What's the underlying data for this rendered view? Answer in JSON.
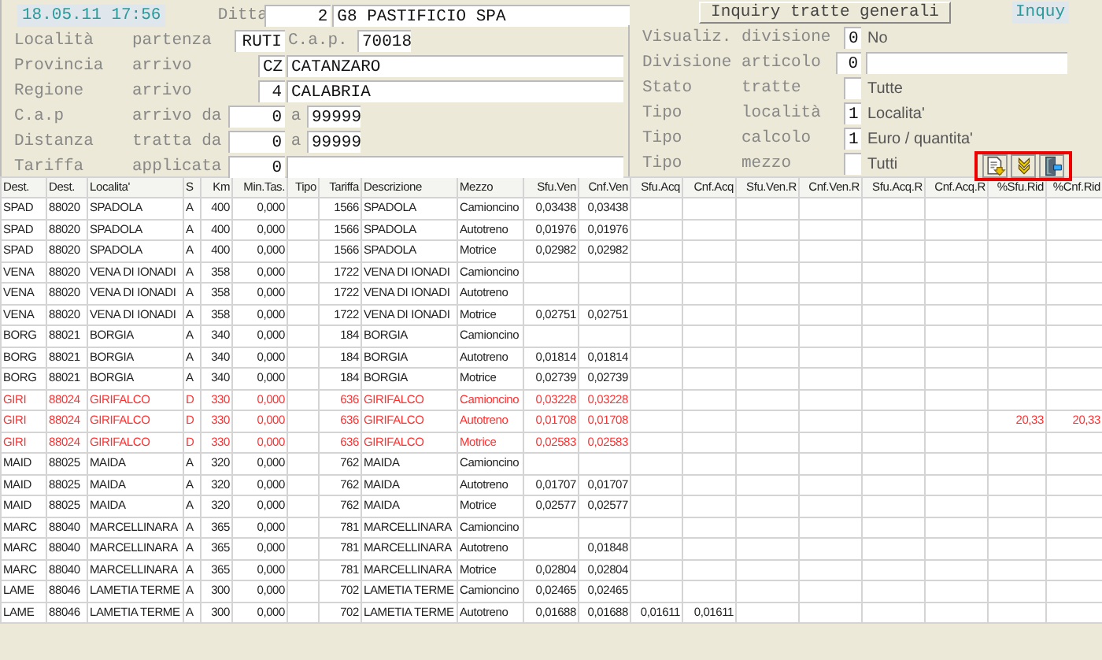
{
  "date_time": "18.05.11 17:56",
  "company": {
    "label": "Ditta",
    "code": "2",
    "name": "G8 PASTIFICIO SPA"
  },
  "left_form": {
    "rows": [
      {
        "label": "Località",
        "label_2": "partenza",
        "items": [
          {
            "kind": "field",
            "value": "RUTI"
          },
          {
            "kind": "label",
            "text": "C.a.p."
          },
          {
            "kind": "field",
            "value": "70018"
          }
        ]
      },
      {
        "label": "Provincia",
        "label_2": "arrivo",
        "items": [
          {
            "kind": "field",
            "value": "CZ"
          },
          {
            "kind": "field",
            "value": "CATANZARO"
          }
        ]
      },
      {
        "label": "Regione",
        "label_2": "arrivo",
        "items": [
          {
            "kind": "field",
            "value": "4"
          },
          {
            "kind": "field",
            "value": "CALABRIA"
          }
        ]
      },
      {
        "label": "C.a.p",
        "label_2": "arrivo da",
        "items": [
          {
            "kind": "field",
            "value": "0"
          },
          {
            "kind": "label",
            "text": "a"
          },
          {
            "kind": "field",
            "value": "99999"
          }
        ]
      },
      {
        "label": "Distanza",
        "label_2": "tratta da",
        "items": [
          {
            "kind": "field",
            "value": "0"
          },
          {
            "kind": "label",
            "text": "a"
          },
          {
            "kind": "field",
            "value": "99999"
          }
        ]
      },
      {
        "label": "Tariffa",
        "label_2": "applicata",
        "items": [
          {
            "kind": "field",
            "value": "0"
          },
          {
            "kind": "field"
          }
        ]
      }
    ]
  },
  "title_button": "Inquiry tratte generali",
  "mode_label": "Inquy",
  "right_form": {
    "rows": [
      {
        "label": "Visualiz.",
        "label_2": "divisione",
        "items": [
          {
            "kind": "field",
            "value": "0"
          },
          {
            "kind": "text",
            "text": "No"
          }
        ]
      },
      {
        "label": "Divisione",
        "label_2": "articolo",
        "items": [
          {
            "kind": "field",
            "value": "0"
          },
          {
            "kind": "field"
          }
        ]
      },
      {
        "label": "Stato",
        "label_2": "tratte",
        "items": [
          {
            "kind": "field"
          },
          {
            "kind": "text",
            "text": "Tutte"
          }
        ]
      },
      {
        "label": "Tipo",
        "label_2": "località",
        "items": [
          {
            "kind": "field",
            "value": "1"
          },
          {
            "kind": "text",
            "text": "Localita'"
          }
        ]
      },
      {
        "label": "Tipo",
        "label_2": "calcolo",
        "items": [
          {
            "kind": "field",
            "value": "1"
          },
          {
            "kind": "text",
            "text": "Euro / quantita'"
          }
        ]
      },
      {
        "label": "Tipo",
        "label_2": "mezzo",
        "items": [
          {
            "kind": "field"
          },
          {
            "kind": "text",
            "text": "Tutti"
          }
        ]
      }
    ]
  },
  "toolbar": [
    {
      "kind": "export"
    },
    {
      "kind": "expand"
    },
    {
      "kind": "exit"
    }
  ],
  "table": {
    "columns": [
      "Dest.",
      "Dest.",
      "Localita'",
      "S",
      "Km",
      "Min.Tas.",
      "Tipo",
      "Tariffa",
      "Descrizione",
      "Mezzo",
      "Sfu.Ven",
      "Cnf.Ven",
      "Sfu.Acq",
      "Cnf.Acq",
      "Sfu.Ven.R",
      "Cnf.Ven.R",
      "Sfu.Acq.R",
      "Cnf.Acq.R",
      "%Sfu.Rid",
      "%Cnf.Rid"
    ],
    "rows": [
      {
        "highlighted": false,
        "cells": [
          "SPAD",
          "88020",
          "SPADOLA",
          "A",
          "400",
          "0,000",
          null,
          "1566",
          "SPADOLA",
          "Camioncino",
          "0,03438",
          "0,03438",
          null,
          null,
          null,
          null,
          null,
          null,
          null,
          null
        ]
      },
      {
        "highlighted": false,
        "cells": [
          "SPAD",
          "88020",
          "SPADOLA",
          "A",
          "400",
          "0,000",
          null,
          "1566",
          "SPADOLA",
          "Autotreno",
          "0,01976",
          "0,01976",
          null,
          null,
          null,
          null,
          null,
          null,
          null,
          null
        ]
      },
      {
        "highlighted": false,
        "cells": [
          "SPAD",
          "88020",
          "SPADOLA",
          "A",
          "400",
          "0,000",
          null,
          "1566",
          "SPADOLA",
          "Motrice",
          "0,02982",
          "0,02982",
          null,
          null,
          null,
          null,
          null,
          null,
          null,
          null
        ]
      },
      {
        "highlighted": false,
        "cells": [
          "VENA",
          "88020",
          "VENA DI IONADI",
          "A",
          "358",
          "0,000",
          null,
          "1722",
          "VENA DI IONADI",
          "Camioncino",
          null,
          null,
          null,
          null,
          null,
          null,
          null,
          null,
          null,
          null
        ]
      },
      {
        "highlighted": false,
        "cells": [
          "VENA",
          "88020",
          "VENA DI IONADI",
          "A",
          "358",
          "0,000",
          null,
          "1722",
          "VENA DI IONADI",
          "Autotreno",
          null,
          null,
          null,
          null,
          null,
          null,
          null,
          null,
          null,
          null
        ]
      },
      {
        "highlighted": false,
        "cells": [
          "VENA",
          "88020",
          "VENA DI IONADI",
          "A",
          "358",
          "0,000",
          null,
          "1722",
          "VENA DI IONADI",
          "Motrice",
          "0,02751",
          "0,02751",
          null,
          null,
          null,
          null,
          null,
          null,
          null,
          null
        ]
      },
      {
        "highlighted": false,
        "cells": [
          "BORG",
          "88021",
          "BORGIA",
          "A",
          "340",
          "0,000",
          null,
          "184",
          "BORGIA",
          "Camioncino",
          null,
          null,
          null,
          null,
          null,
          null,
          null,
          null,
          null,
          null
        ]
      },
      {
        "highlighted": false,
        "cells": [
          "BORG",
          "88021",
          "BORGIA",
          "A",
          "340",
          "0,000",
          null,
          "184",
          "BORGIA",
          "Autotreno",
          "0,01814",
          "0,01814",
          null,
          null,
          null,
          null,
          null,
          null,
          null,
          null
        ]
      },
      {
        "highlighted": false,
        "cells": [
          "BORG",
          "88021",
          "BORGIA",
          "A",
          "340",
          "0,000",
          null,
          "184",
          "BORGIA",
          "Motrice",
          "0,02739",
          "0,02739",
          null,
          null,
          null,
          null,
          null,
          null,
          null,
          null
        ]
      },
      {
        "highlighted": true,
        "cells": [
          "GIRI",
          "88024",
          "GIRIFALCO",
          "D",
          "330",
          "0,000",
          null,
          "636",
          "GIRIFALCO",
          "Camioncino",
          "0,03228",
          "0,03228",
          null,
          null,
          null,
          null,
          null,
          null,
          null,
          null
        ]
      },
      {
        "highlighted": true,
        "cells": [
          "GIRI",
          "88024",
          "GIRIFALCO",
          "D",
          "330",
          "0,000",
          null,
          "636",
          "GIRIFALCO",
          "Autotreno",
          "0,01708",
          "0,01708",
          null,
          null,
          null,
          null,
          null,
          null,
          "20,33",
          "20,33"
        ]
      },
      {
        "highlighted": true,
        "cells": [
          "GIRI",
          "88024",
          "GIRIFALCO",
          "D",
          "330",
          "0,000",
          null,
          "636",
          "GIRIFALCO",
          "Motrice",
          "0,02583",
          "0,02583",
          null,
          null,
          null,
          null,
          null,
          null,
          null,
          null
        ]
      },
      {
        "highlighted": false,
        "cells": [
          "MAID",
          "88025",
          "MAIDA",
          "A",
          "320",
          "0,000",
          null,
          "762",
          "MAIDA",
          "Camioncino",
          null,
          null,
          null,
          null,
          null,
          null,
          null,
          null,
          null,
          null
        ]
      },
      {
        "highlighted": false,
        "cells": [
          "MAID",
          "88025",
          "MAIDA",
          "A",
          "320",
          "0,000",
          null,
          "762",
          "MAIDA",
          "Autotreno",
          "0,01707",
          "0,01707",
          null,
          null,
          null,
          null,
          null,
          null,
          null,
          null
        ]
      },
      {
        "highlighted": false,
        "cells": [
          "MAID",
          "88025",
          "MAIDA",
          "A",
          "320",
          "0,000",
          null,
          "762",
          "MAIDA",
          "Motrice",
          "0,02577",
          "0,02577",
          null,
          null,
          null,
          null,
          null,
          null,
          null,
          null
        ]
      },
      {
        "highlighted": false,
        "cells": [
          "MARC",
          "88040",
          "MARCELLINARA",
          "A",
          "365",
          "0,000",
          null,
          "781",
          "MARCELLINARA",
          "Camioncino",
          null,
          null,
          null,
          null,
          null,
          null,
          null,
          null,
          null,
          null
        ]
      },
      {
        "highlighted": false,
        "cells": [
          "MARC",
          "88040",
          "MARCELLINARA",
          "A",
          "365",
          "0,000",
          null,
          "781",
          "MARCELLINARA",
          "Autotreno",
          null,
          "0,01848",
          null,
          null,
          null,
          null,
          null,
          null,
          null,
          null
        ]
      },
      {
        "highlighted": false,
        "cells": [
          "MARC",
          "88040",
          "MARCELLINARA",
          "A",
          "365",
          "0,000",
          null,
          "781",
          "MARCELLINARA",
          "Motrice",
          "0,02804",
          "0,02804",
          null,
          null,
          null,
          null,
          null,
          null,
          null,
          null
        ]
      },
      {
        "highlighted": false,
        "cells": [
          "LAME",
          "88046",
          "LAMETIA TERME",
          "A",
          "300",
          "0,000",
          null,
          "702",
          "LAMETIA TERME",
          "Camioncino",
          "0,02465",
          "0,02465",
          null,
          null,
          null,
          null,
          null,
          null,
          null,
          null
        ]
      },
      {
        "highlighted": false,
        "cells": [
          "LAME",
          "88046",
          "LAMETIA TERME",
          "A",
          "300",
          "0,000",
          null,
          "702",
          "LAMETIA TERME",
          "Autotreno",
          "0,01688",
          "0,01688",
          "0,01611",
          "0,01611",
          null,
          null,
          null,
          null,
          null,
          null
        ]
      }
    ]
  }
}
